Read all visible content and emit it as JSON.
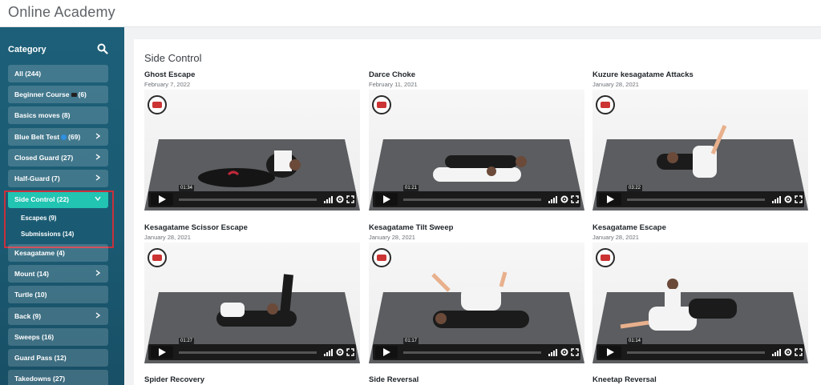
{
  "header": {
    "title": "Online Academy"
  },
  "sidebar": {
    "heading": "Category",
    "categories": [
      {
        "label": "All (244)",
        "has_chevron": false
      },
      {
        "label": "Beginner Course",
        "count": "(6)",
        "icon": "belt-icon",
        "has_chevron": false
      },
      {
        "label": "Basics moves (8)",
        "has_chevron": false
      },
      {
        "label": "Blue Belt Test",
        "count": "(69)",
        "icon": "blue-belt-icon",
        "has_chevron": true
      },
      {
        "label": "Closed Guard (27)",
        "has_chevron": true
      },
      {
        "label": "Half-Guard (7)",
        "has_chevron": true
      },
      {
        "label": "Side Control (22)",
        "has_chevron": true,
        "active": true
      },
      {
        "label": "Kesagatame (4)",
        "has_chevron": false
      },
      {
        "label": "Mount (14)",
        "has_chevron": true
      },
      {
        "label": "Turtle (10)",
        "has_chevron": false
      },
      {
        "label": "Back (9)",
        "has_chevron": true
      },
      {
        "label": "Sweeps (16)",
        "has_chevron": false
      },
      {
        "label": "Guard Pass (12)",
        "has_chevron": false
      },
      {
        "label": "Takedowns (27)",
        "has_chevron": false
      }
    ],
    "subcategories": [
      {
        "label": "Escapes (9)"
      },
      {
        "label": "Submissions (14)"
      }
    ],
    "highlight_color": "#c8303d",
    "active_color": "#22c4b2"
  },
  "main": {
    "section_title": "Side Control",
    "videos": [
      {
        "title": "Ghost Escape",
        "date": "February 7, 2022",
        "duration": "01:34"
      },
      {
        "title": "Darce Choke",
        "date": "February 11, 2021",
        "duration": "01:21"
      },
      {
        "title": "Kuzure kesagatame Attacks",
        "date": "January 28, 2021",
        "duration": "03:22"
      },
      {
        "title": "Kesagatame Scissor Escape",
        "date": "January 28, 2021",
        "duration": "01:27"
      },
      {
        "title": "Kesagatame Tilt Sweep",
        "date": "January 28, 2021",
        "duration": "01:17"
      },
      {
        "title": "Kesagatame Escape",
        "date": "January 28, 2021",
        "duration": "01:14"
      },
      {
        "title": "Spider Recovery"
      },
      {
        "title": "Side Reversal"
      },
      {
        "title": "Kneetap Reversal"
      }
    ]
  }
}
